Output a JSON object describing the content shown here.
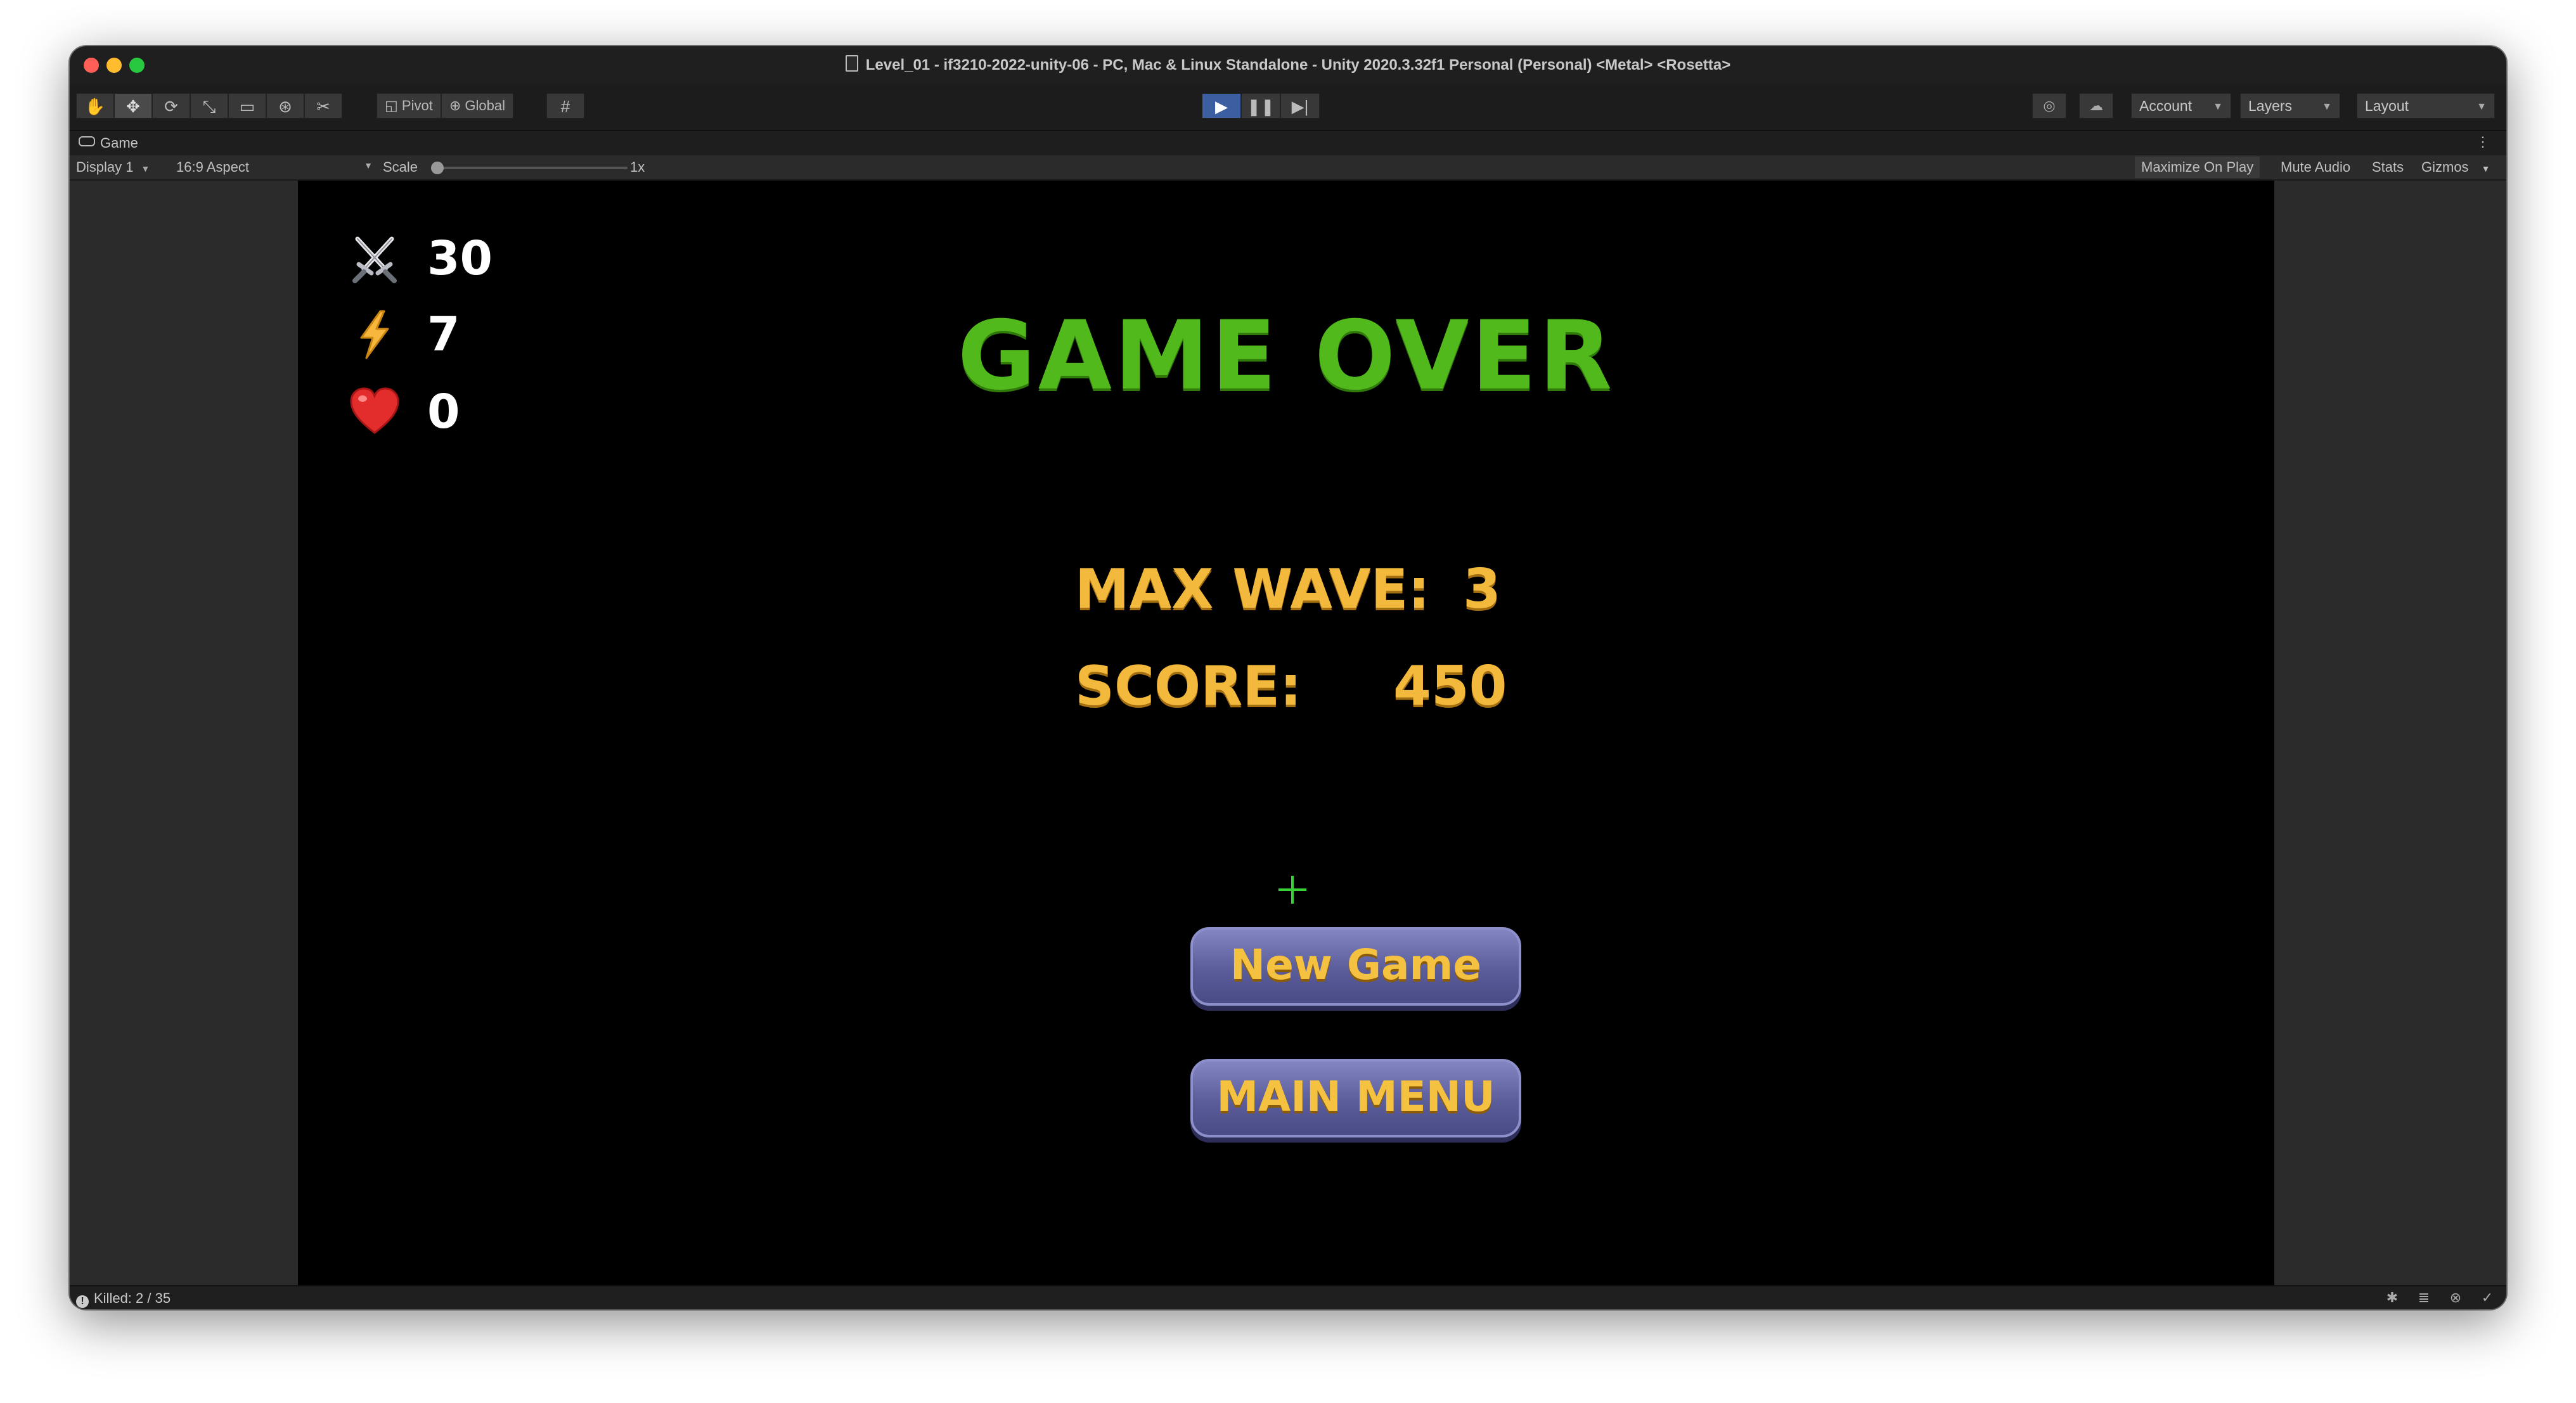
{
  "window": {
    "title": "Level_01 - if3210-2022-unity-06 - PC, Mac & Linux Standalone - Unity 2020.3.32f1 Personal (Personal) <Metal> <Rosetta>"
  },
  "toolbar": {
    "tools": [
      "hand-tool",
      "move-tool",
      "rotate-tool",
      "scale-tool",
      "rect-tool",
      "transform-tool",
      "custom-tool"
    ],
    "pivot_label": "Pivot",
    "global_label": "Global",
    "account_label": "Account",
    "layers_label": "Layers",
    "layout_label": "Layout"
  },
  "game_tab": {
    "label": "Game",
    "display": "Display 1",
    "aspect": "16:9 Aspect",
    "scale_label": "Scale",
    "scale_value": "1x",
    "maximize_on_play": "Maximize On Play",
    "mute_audio": "Mute Audio",
    "stats": "Stats",
    "gizmos": "Gizmos"
  },
  "hud": {
    "attack": "30",
    "speed": "7",
    "health": "0"
  },
  "game_over": {
    "title": "GAME OVER",
    "max_wave_label": "MAX WAVE:",
    "max_wave_value": "3",
    "score_label": "SCORE:",
    "score_value": "450",
    "new_game_button": "New Game",
    "main_menu_button": "MAIN MENU"
  },
  "status": {
    "text": "Killed: 2 / 35"
  },
  "colors": {
    "title_green": "#52b91d",
    "stat_yellow": "#f2b93d",
    "button_purple": "#5a5d9a",
    "play_blue": "#3b5fa0"
  }
}
